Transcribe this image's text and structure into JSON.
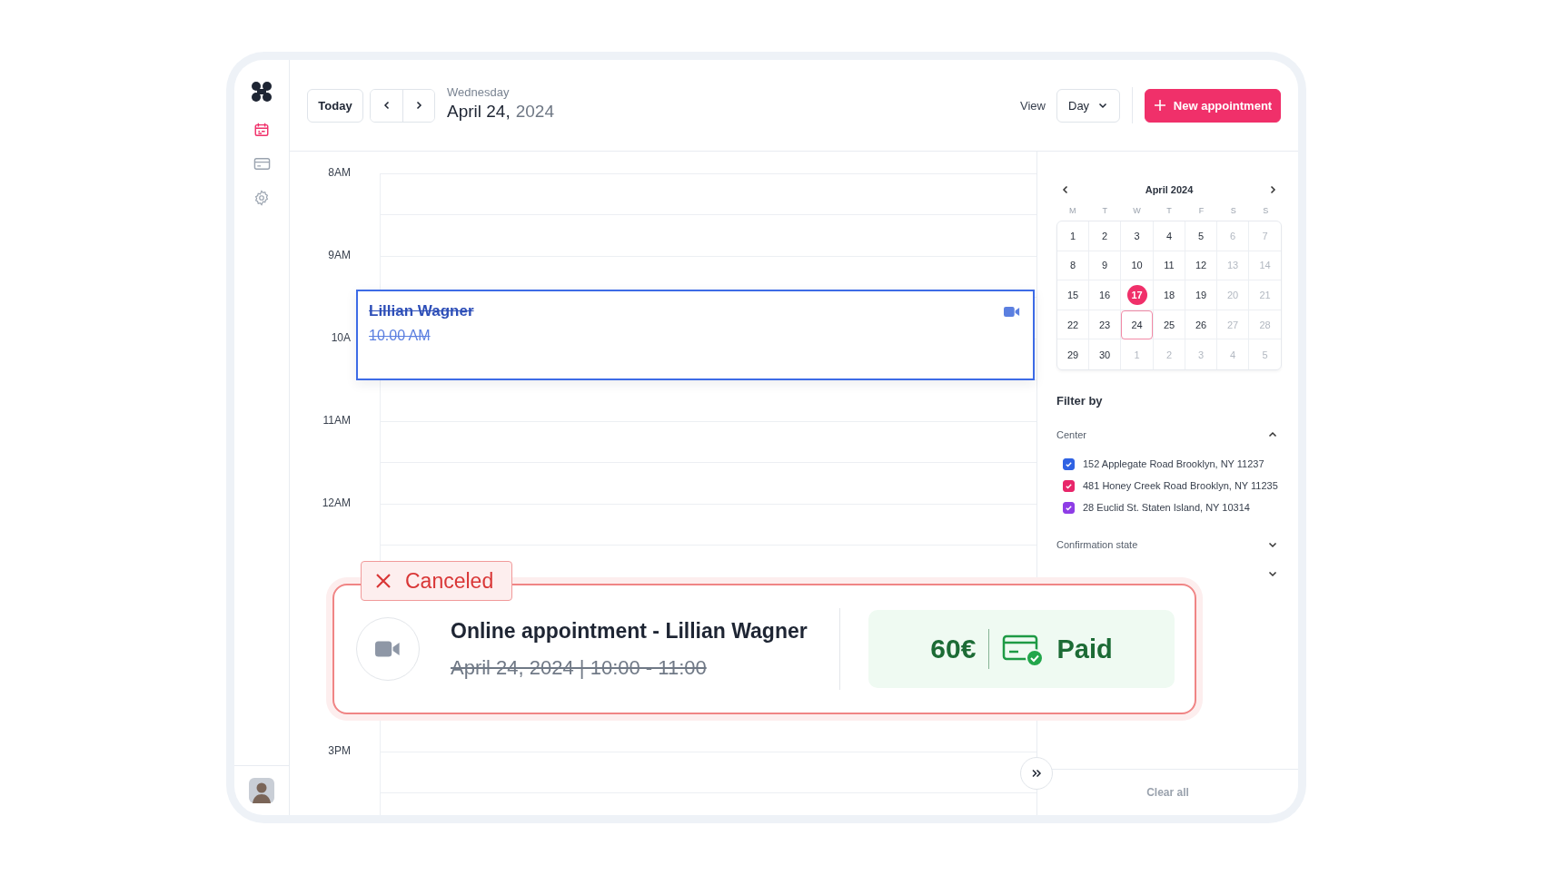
{
  "sidebar": {
    "items": [
      {
        "kind": "calendar",
        "selected": true
      },
      {
        "kind": "card",
        "selected": false
      },
      {
        "kind": "settings",
        "selected": false
      }
    ]
  },
  "header": {
    "today_button": "Today",
    "weekday": "Wednesday",
    "date": "April 24,",
    "year": "2024",
    "view_label": "View",
    "view_value": "Day",
    "new_button": "New appointment"
  },
  "timeline": {
    "hours": [
      "8AM",
      "9AM",
      "10A",
      "11AM",
      "12AM"
    ],
    "last_hour": "3PM"
  },
  "event": {
    "name": "Lillian Wagner",
    "time": "10.00 AM",
    "canceled": true
  },
  "mini_calendar": {
    "title": "April 2024",
    "weekdays": [
      "M",
      "T",
      "W",
      "T",
      "F",
      "S",
      "S"
    ],
    "days": [
      {
        "label": "1",
        "muted": false,
        "today": false,
        "selected": false
      },
      {
        "label": "2",
        "muted": false,
        "today": false,
        "selected": false
      },
      {
        "label": "3",
        "muted": false,
        "today": false,
        "selected": false
      },
      {
        "label": "4",
        "muted": false,
        "today": false,
        "selected": false
      },
      {
        "label": "5",
        "muted": false,
        "today": false,
        "selected": false
      },
      {
        "label": "6",
        "muted": true,
        "today": false,
        "selected": false
      },
      {
        "label": "7",
        "muted": true,
        "today": false,
        "selected": false
      },
      {
        "label": "8",
        "muted": false,
        "today": false,
        "selected": false
      },
      {
        "label": "9",
        "muted": false,
        "today": false,
        "selected": false
      },
      {
        "label": "10",
        "muted": false,
        "today": false,
        "selected": false
      },
      {
        "label": "11",
        "muted": false,
        "today": false,
        "selected": false
      },
      {
        "label": "12",
        "muted": false,
        "today": false,
        "selected": false
      },
      {
        "label": "13",
        "muted": true,
        "today": false,
        "selected": false
      },
      {
        "label": "14",
        "muted": true,
        "today": false,
        "selected": false
      },
      {
        "label": "15",
        "muted": false,
        "today": false,
        "selected": false
      },
      {
        "label": "16",
        "muted": false,
        "today": false,
        "selected": false
      },
      {
        "label": "17",
        "muted": false,
        "today": true,
        "selected": false
      },
      {
        "label": "18",
        "muted": false,
        "today": false,
        "selected": false
      },
      {
        "label": "19",
        "muted": false,
        "today": false,
        "selected": false
      },
      {
        "label": "20",
        "muted": true,
        "today": false,
        "selected": false
      },
      {
        "label": "21",
        "muted": true,
        "today": false,
        "selected": false
      },
      {
        "label": "22",
        "muted": false,
        "today": false,
        "selected": false
      },
      {
        "label": "23",
        "muted": false,
        "today": false,
        "selected": false
      },
      {
        "label": "24",
        "muted": false,
        "today": false,
        "selected": true
      },
      {
        "label": "25",
        "muted": false,
        "today": false,
        "selected": false
      },
      {
        "label": "26",
        "muted": false,
        "today": false,
        "selected": false
      },
      {
        "label": "27",
        "muted": true,
        "today": false,
        "selected": false
      },
      {
        "label": "28",
        "muted": true,
        "today": false,
        "selected": false
      },
      {
        "label": "29",
        "muted": false,
        "today": false,
        "selected": false
      },
      {
        "label": "30",
        "muted": false,
        "today": false,
        "selected": false
      },
      {
        "label": "1",
        "muted": true,
        "today": false,
        "selected": false
      },
      {
        "label": "2",
        "muted": true,
        "today": false,
        "selected": false
      },
      {
        "label": "3",
        "muted": true,
        "today": false,
        "selected": false
      },
      {
        "label": "4",
        "muted": true,
        "today": false,
        "selected": false
      },
      {
        "label": "5",
        "muted": true,
        "today": false,
        "selected": false
      }
    ]
  },
  "filter": {
    "title": "Filter by",
    "groups": [
      {
        "label": "Center",
        "expanded": true,
        "options": [
          {
            "label": "152 Applegate Road Brooklyn, NY 11237",
            "checked": true,
            "color": "#2f62e3"
          },
          {
            "label": "481 Honey Creek Road Brooklyn, NY 11235",
            "checked": true,
            "color": "#e8266a"
          },
          {
            "label": "28 Euclid St. Staten Island, NY 10314",
            "checked": true,
            "color": "#8e3de6"
          }
        ]
      },
      {
        "label": "Confirmation state",
        "expanded": false
      },
      {
        "expanded": false
      }
    ]
  },
  "clear_all": "Clear all",
  "popup": {
    "status": "Canceled",
    "title": "Online appointment - Lillian Wagner",
    "datetime": "April 24, 2024 | 10:00 - 11:00",
    "canceled": true,
    "price": "60€",
    "payment": "Paid"
  }
}
